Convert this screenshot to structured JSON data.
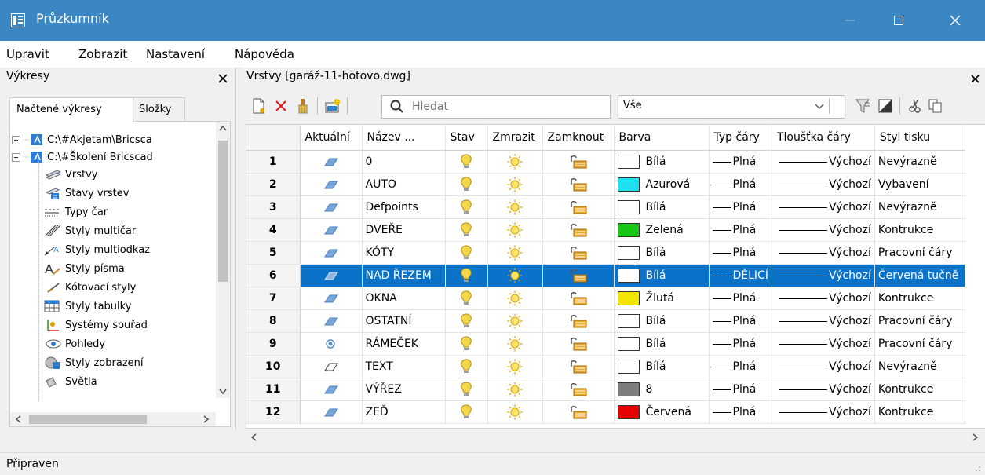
{
  "window": {
    "title": "Průzkumník"
  },
  "menu": [
    {
      "label": "Upravit"
    },
    {
      "label": "Zobrazit"
    },
    {
      "label": "Nastavení"
    },
    {
      "label": "Nápověda"
    }
  ],
  "left_panel": {
    "title": "Výkresy",
    "tabs": [
      {
        "label": "Načtené výkresy"
      },
      {
        "label": "Složky"
      }
    ],
    "tree": [
      {
        "label": "C:\\#Akjetam\\Bricsca"
      },
      {
        "label": "C:\\#Školení Bricscad"
      },
      {
        "label": "Vrstvy"
      },
      {
        "label": "Stavy vrstev"
      },
      {
        "label": "Typy čar"
      },
      {
        "label": "Styly multičar"
      },
      {
        "label": "Styly multiodkaz"
      },
      {
        "label": "Styly písma"
      },
      {
        "label": "Kótovací styly"
      },
      {
        "label": "Styly tabulky"
      },
      {
        "label": "Systémy souřad"
      },
      {
        "label": "Pohledy"
      },
      {
        "label": "Styly zobrazení"
      },
      {
        "label": "Světla"
      }
    ]
  },
  "right_panel": {
    "title": "Vrstvy [garáž-11-hotovo.dwg]",
    "search_placeholder": "Hledat",
    "filter_value": "Vše"
  },
  "grid": {
    "columns": [
      "",
      "Aktuální",
      "Název ...",
      "Stav",
      "Zmrazit",
      "Zamknout",
      "Barva",
      "Typ čáry",
      "Tloušťka čáry",
      "Styl tisku"
    ],
    "rows": [
      {
        "num": "1",
        "current": "layer",
        "name": "0",
        "color": "#ffffff",
        "color_name": "Bílá",
        "linetype": "Plná",
        "lineweight": "Výchozí",
        "plotstyle": "Nevýrazně"
      },
      {
        "num": "2",
        "current": "layer",
        "name": "AUTO",
        "color": "#1ee0ee",
        "color_name": "Azurová",
        "linetype": "Plná",
        "lineweight": "Výchozí",
        "plotstyle": "Vybavení"
      },
      {
        "num": "3",
        "current": "layer",
        "name": "Defpoints",
        "color": "#ffffff",
        "color_name": "Bílá",
        "linetype": "Plná",
        "lineweight": "Výchozí",
        "plotstyle": "Nevýrazně"
      },
      {
        "num": "4",
        "current": "layer",
        "name": "DVEŘE",
        "color": "#17c817",
        "color_name": "Zelená",
        "linetype": "Plná",
        "lineweight": "Výchozí",
        "plotstyle": "Kontrukce"
      },
      {
        "num": "5",
        "current": "layer",
        "name": "KÓTY",
        "color": "#ffffff",
        "color_name": "Bílá",
        "linetype": "Plná",
        "lineweight": "Výchozí",
        "plotstyle": "Pracovní čáry"
      },
      {
        "num": "6",
        "current": "layer",
        "name": "NAD ŘEZEM",
        "color": "#ffffff",
        "color_name": "Bílá",
        "linetype": "DĚLICÍ",
        "lineweight": "Výchozí",
        "plotstyle": "Červená tučně",
        "selected": true
      },
      {
        "num": "7",
        "current": "layer",
        "name": "OKNA",
        "color": "#f2e600",
        "color_name": "Žlutá",
        "linetype": "Plná",
        "lineweight": "Výchozí",
        "plotstyle": "Kontrukce"
      },
      {
        "num": "8",
        "current": "layer",
        "name": "OSTATNÍ",
        "color": "#ffffff",
        "color_name": "Bílá",
        "linetype": "Plná",
        "lineweight": "Výchozí",
        "plotstyle": "Pracovní čáry"
      },
      {
        "num": "9",
        "current": "dot",
        "name": "RÁMEČEK",
        "color": "#ffffff",
        "color_name": "Bílá",
        "linetype": "Plná",
        "lineweight": "Výchozí",
        "plotstyle": "Pracovní čáry"
      },
      {
        "num": "10",
        "current": "outline",
        "name": "TEXT",
        "color": "#ffffff",
        "color_name": "Bílá",
        "linetype": "Plná",
        "lineweight": "Výchozí",
        "plotstyle": "Nevýrazně"
      },
      {
        "num": "11",
        "current": "layer",
        "name": "VÝŘEZ",
        "color": "#7d7d7d",
        "color_name": "8",
        "linetype": "Plná",
        "lineweight": "Výchozí",
        "plotstyle": "Kontrukce"
      },
      {
        "num": "12",
        "current": "layer",
        "name": "ZEĎ",
        "color": "#e60000",
        "color_name": "Červená",
        "linetype": "Plná",
        "lineweight": "Výchozí",
        "plotstyle": "Kontrukce"
      }
    ]
  },
  "status": {
    "text": "Připraven"
  },
  "colors": {
    "titlebar": "#3b87c3",
    "selection": "#0a73c9"
  }
}
